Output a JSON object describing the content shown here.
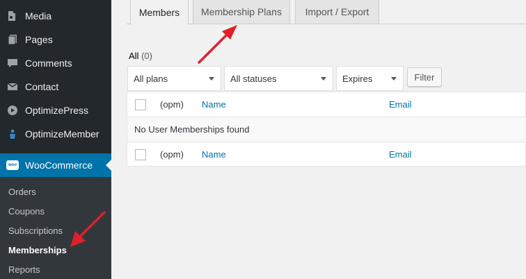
{
  "sidebar": {
    "items": [
      {
        "label": "Media",
        "icon": "media-icon"
      },
      {
        "label": "Pages",
        "icon": "pages-icon"
      },
      {
        "label": "Comments",
        "icon": "comments-icon"
      },
      {
        "label": "Contact",
        "icon": "contact-icon"
      },
      {
        "label": "OptimizePress",
        "icon": "optimizepress-icon"
      },
      {
        "label": "OptimizeMember",
        "icon": "optimizemember-icon"
      }
    ],
    "woocommerce": {
      "label": "WooCommerce",
      "badge": "woo"
    },
    "submenu": [
      {
        "label": "Orders"
      },
      {
        "label": "Coupons"
      },
      {
        "label": "Subscriptions"
      },
      {
        "label": "Memberships",
        "current": true
      },
      {
        "label": "Reports"
      }
    ]
  },
  "tabs": [
    {
      "label": "Members",
      "active": true
    },
    {
      "label": "Membership Plans"
    },
    {
      "label": "Import / Export"
    }
  ],
  "filters": {
    "all_label": "All",
    "all_count": "(0)",
    "plans_select": "All plans",
    "statuses_select": "All statuses",
    "expires_select": "Expires",
    "filter_button": "Filter"
  },
  "table": {
    "columns": {
      "opm": "(opm)",
      "name": "Name",
      "email": "Email"
    },
    "empty_message": "No User Memberships found"
  },
  "colors": {
    "sidebar_bg": "#23282d",
    "submenu_bg": "#32373c",
    "accent": "#0073aa",
    "annotation_arrow": "#e0202a"
  }
}
